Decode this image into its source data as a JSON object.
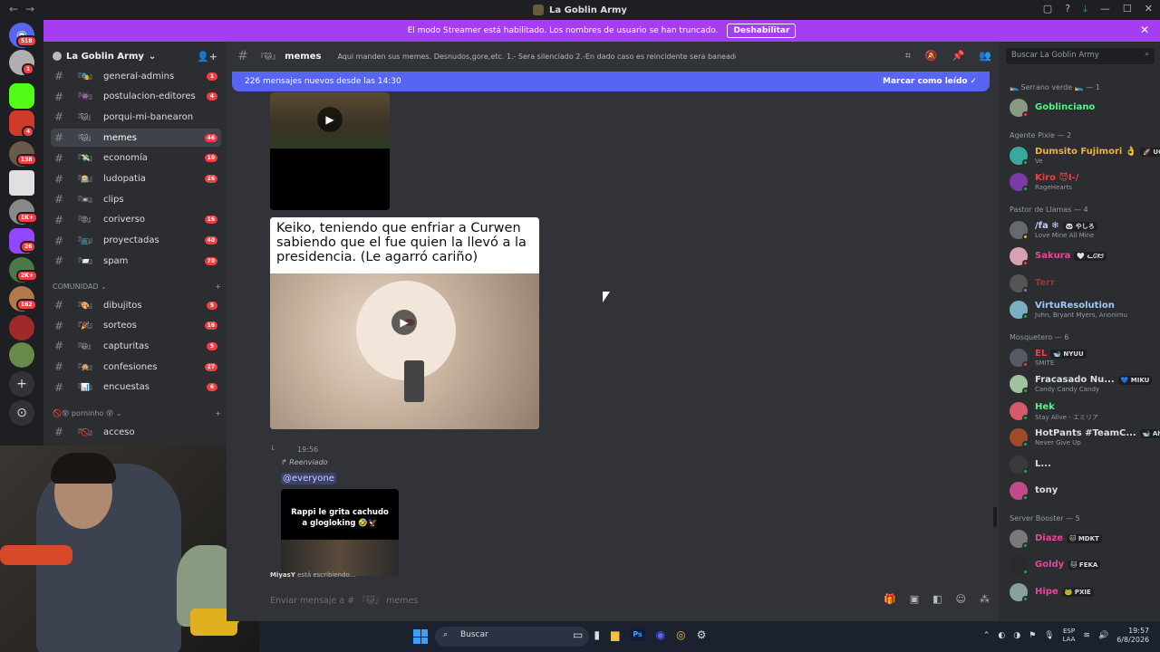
{
  "window": {
    "title": "La Goblin Army"
  },
  "banner": {
    "text": "El modo Streamer está habilitado. Los nombres de usuario se han truncado.",
    "button": "Deshabilitar"
  },
  "rail": {
    "badges": [
      "518",
      "1",
      "4",
      "138",
      "1K+",
      "26",
      "2K+",
      "162"
    ]
  },
  "server": {
    "name": "La Goblin Army"
  },
  "channels": [
    {
      "emoji": "『🎭』",
      "name": "general-admins",
      "count": "1"
    },
    {
      "emoji": "『👾』",
      "name": "postulacion-editores",
      "count": "4"
    },
    {
      "emoji": "『🐱』",
      "name": "porqui-mi-banearon",
      "count": ""
    },
    {
      "emoji": "『🐱』",
      "name": "memes",
      "count": "46",
      "active": true
    },
    {
      "emoji": "『💸』",
      "name": "economía",
      "count": "10"
    },
    {
      "emoji": "『🎰』",
      "name": "ludopatia",
      "count": "26"
    },
    {
      "emoji": "『📼』",
      "name": "clips",
      "count": ""
    },
    {
      "emoji": "『😡』",
      "name": "coriverso",
      "count": "16"
    },
    {
      "emoji": "『📺』",
      "name": "proyectadas",
      "count": "40"
    },
    {
      "emoji": "『📨』",
      "name": "spam",
      "count": "70"
    }
  ],
  "categories": {
    "comunidad": "COMUNIDAD",
    "porninho": "porninho"
  },
  "community_channels": [
    {
      "emoji": "『🎨』",
      "name": "dibujitos",
      "count": "5"
    },
    {
      "emoji": "『🎉』",
      "name": "sorteos",
      "count": "16"
    },
    {
      "emoji": "『😃』",
      "name": "capturitas",
      "count": "5"
    },
    {
      "emoji": "『🙊』",
      "name": "confesiones",
      "count": "27"
    },
    {
      "emoji": "『📊』",
      "name": "encuestas",
      "count": "6"
    }
  ],
  "porninho_channels": [
    {
      "emoji": "『🚫』",
      "name": "acceso",
      "count": ""
    }
  ],
  "chat": {
    "channel_emoji": "『🐱』",
    "channel_name": "memes",
    "topic": "Aqui manden sus memes. Desnudos,gore,etc. 1.- Sera silenciado 2.-En dado caso es reincidente sera baneado",
    "new_messages": "226 mensajes nuevos desde las 14:30",
    "mark_read": "Marcar como leído",
    "meme_caption": "Keiko, teniendo que enfriar a Curwen sabiendo que el fue quien la llevó a la presidencia. (Le agarró cariño)",
    "msg_time": "19:56",
    "forwarded": "Reenviado",
    "mention": "@everyone",
    "card_caption": "Rappi le grita cachudo a glogloking 🤣🦅",
    "typing_user": "MiyasY",
    "typing_text": "está escribiendo...",
    "composer_placeholder": "Enviar mensaje a # 『🐱』 memes"
  },
  "members": {
    "search_placeholder": "Buscar La Goblin Army",
    "groups": [
      {
        "title": "🛌 Serrano verde 🛌 — 1",
        "items": [
          {
            "name": "Goblinciano",
            "color": "#57f287",
            "status": "",
            "tag": "",
            "avatar": "#8a9a80",
            "dot": "#f23f43"
          }
        ]
      },
      {
        "title": "Agente Pixie — 2",
        "items": [
          {
            "name": "Dumsito Fujimori 👌",
            "color": "#f0b232",
            "status": "Ve",
            "tag": "🚀 UC",
            "avatar": "#3aa89a",
            "dot": "#23a559"
          },
          {
            "name": "Kiro 😈I-/",
            "color": "#f23f43",
            "status": "RageHearts",
            "tag": "",
            "avatar": "#7a3aa8",
            "dot": "#23a559"
          }
        ]
      },
      {
        "title": "Pastor de Llamas — 4",
        "items": [
          {
            "name": "/fa ❄",
            "color": "#c9cdfb",
            "status": "Love Mine All Mine",
            "tag": "🐼 やしろ",
            "avatar": "#666a70",
            "dot": "#f0b232"
          },
          {
            "name": "Sakura",
            "color": "#eb459e",
            "status": "",
            "tag": "🤍 ᓚᘏᗢ",
            "avatar": "#d8a0b0",
            "dot": "#f23f43"
          },
          {
            "name": "Terr",
            "color": "#8a3a3a",
            "status": "",
            "tag": "",
            "avatar": "#555",
            "dot": "#80848e"
          },
          {
            "name": "VirtuResolution",
            "color": "#a0c8ff",
            "status": "Juhn, Bryant Myers, Anonimu",
            "tag": "",
            "avatar": "#7ab0c0",
            "dot": "#23a559"
          }
        ]
      },
      {
        "title": "Mosquetero — 6",
        "items": [
          {
            "name": "EL",
            "color": "#f23f43",
            "status": "SMITE",
            "tag": "🐋 NYUU",
            "avatar": "#555a66",
            "dot": "#f23f43"
          },
          {
            "name": "Fracasado Nu...",
            "color": "#dbdee1",
            "status": "Candy Candy Candy",
            "tag": "💙 MIKU",
            "avatar": "#a0c0a0",
            "dot": "#23a559"
          },
          {
            "name": "Hek",
            "color": "#57f287",
            "status": "Stay Alive - エミリア",
            "tag": "",
            "avatar": "#d85a6a",
            "dot": "#23a559"
          },
          {
            "name": "HotPants #TeamC...",
            "color": "#dbdee1",
            "status": "Never Give Up",
            "tag": "🐋 Ahri",
            "avatar": "#a04a2a",
            "dot": "#23a559"
          },
          {
            "name": "L...",
            "color": "#dbdee1",
            "status": "",
            "tag": "",
            "avatar": "#3a3a3a",
            "dot": "#23a559"
          },
          {
            "name": "tony",
            "color": "#dbdee1",
            "status": "",
            "tag": "",
            "avatar": "#c04a8a",
            "dot": "#23a559"
          }
        ]
      },
      {
        "title": "Server Booster — 5",
        "items": [
          {
            "name": "Diaze",
            "color": "#eb459e",
            "status": "",
            "tag": "🐱 MDKT",
            "avatar": "#7a7a7a",
            "dot": "#23a559"
          },
          {
            "name": "Goldy",
            "color": "#eb459e",
            "status": "",
            "tag": "🐱 FEKA",
            "avatar": "#2a2a2a",
            "dot": "#23a559"
          },
          {
            "name": "Hipe",
            "color": "#eb459e",
            "status": "",
            "tag": "🐸 PXIE",
            "avatar": "#8aa0a0",
            "dot": "#23a559"
          }
        ]
      }
    ]
  },
  "taskbar": {
    "search": "Buscar",
    "lang_top": "ESP",
    "lang_bottom": "LAA",
    "time": "19:57",
    "date": "6/8/2026"
  }
}
